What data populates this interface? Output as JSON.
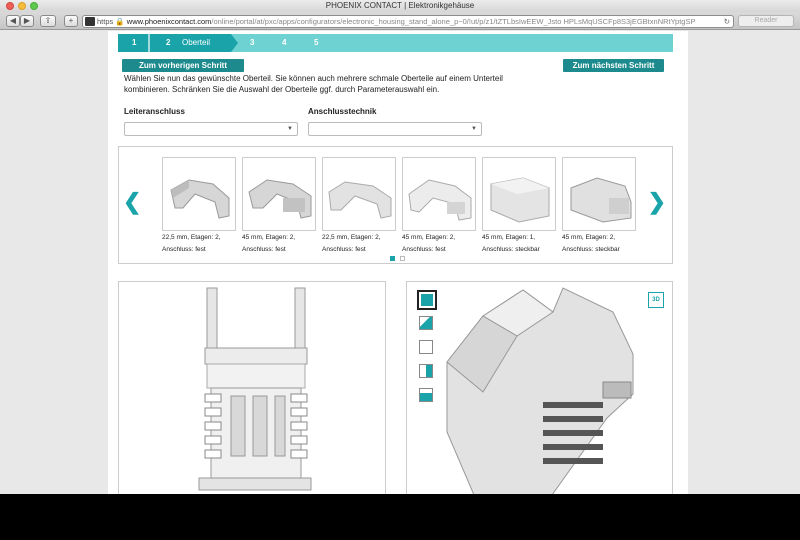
{
  "browser": {
    "window_title": "PHOENIX CONTACT | Elektronikgehäuse",
    "https_label": "https",
    "url_domain": "www.phoenixcontact.com",
    "url_path": "/online/portal/at/pxc/apps/configurators/electronic_housing_stand_alone_p~0/!ut/p/z1/tZTLbsIwEEW_Jsto HPLsMqUSCFp8S3jEGBtxnNRtYptgSP",
    "reader_label": "Reader"
  },
  "steps": [
    {
      "num": "1",
      "label": ""
    },
    {
      "num": "2",
      "label": "Oberteil"
    },
    {
      "num": "3",
      "label": ""
    },
    {
      "num": "4",
      "label": ""
    },
    {
      "num": "5",
      "label": ""
    }
  ],
  "buttons": {
    "prev": "Zum vorherigen Schritt",
    "next": "Zum nächsten Schritt"
  },
  "intro_text": "Wählen Sie nun das gewünschte Oberteil. Sie können auch mehrere schmale Oberteile auf einem Unterteil kombinieren. Schränken Sie die Auswahl der Oberteile ggf. durch Parameterauswahl ein.",
  "filters": {
    "leiter_label": "Leiteranschluss",
    "leiter_value": "",
    "technik_label": "Anschlusstechnik",
    "technik_value": ""
  },
  "carousel": {
    "items": [
      {
        "line1": "22,5 mm, Etagen: 2,",
        "line2": "Anschluss: fest"
      },
      {
        "line1": "45 mm, Etagen: 2,",
        "line2": "Anschluss: fest"
      },
      {
        "line1": "22,5 mm, Etagen: 2,",
        "line2": "Anschluss: fest"
      },
      {
        "line1": "45 mm, Etagen: 2,",
        "line2": "Anschluss: fest"
      },
      {
        "line1": "45 mm, Etagen: 1,",
        "line2": "Anschluss: steckbar"
      },
      {
        "line1": "45 mm, Etagen: 2,",
        "line2": "Anschluss: steckbar"
      }
    ],
    "page_count": 2,
    "active_page": 1
  },
  "viewer": {
    "badge_label": "3D",
    "views": [
      "view-3d",
      "view-front",
      "view-side",
      "view-top",
      "view-iso"
    ]
  },
  "colors": {
    "teal": "#1d8a8e",
    "step_bar": "#6fd2d2",
    "accent": "#1aa4aa"
  }
}
